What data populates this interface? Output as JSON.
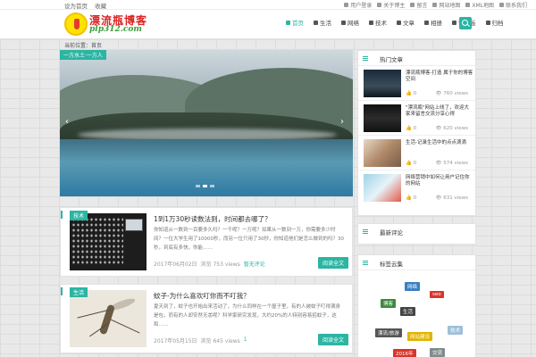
{
  "topbar": {
    "left_links": [
      "设为首页",
      "收藏"
    ],
    "right_links": [
      "用户登录",
      "关于博主",
      "留言",
      "网站地图",
      "XML地图",
      "联系我们"
    ]
  },
  "header": {
    "logo_text": "漂流瓶博客",
    "logo_sub": "plp312.com",
    "nav": [
      {
        "label": "首页",
        "icon": "home-icon",
        "active": true
      },
      {
        "label": "生活",
        "icon": "people-icon",
        "active": false
      },
      {
        "label": "网络",
        "icon": "send-icon",
        "active": false
      },
      {
        "label": "技术",
        "icon": "book-icon",
        "active": false
      },
      {
        "label": "文章",
        "icon": "trophy-icon",
        "active": false
      },
      {
        "label": "相册",
        "icon": "camera-icon",
        "active": false
      },
      {
        "label": "留言板",
        "icon": "chat-icon",
        "active": false
      },
      {
        "label": "归档",
        "icon": "archive-icon",
        "active": false
      }
    ]
  },
  "breadcrumb": "当前位置：首页",
  "slider": {
    "caption": "一方水土·一方人",
    "dots": 3,
    "active_dot": 2
  },
  "posts": [
    {
      "tag": "技术",
      "title": "1到1万30秒读数法则，时间都去哪了？",
      "excerpt": "你知道从一数到一百要多久吗？一千呢？一万呢？如果从一数到一万，你需要多少时间？一位大学生用了10000秒，而另一位只用了30秒，你知道他们是怎么做到的吗？30秒，到底有多快，你能……",
      "date": "2017年06月02日",
      "views": "浏览 753 views",
      "comment": "暂无评论",
      "more": "阅读全文"
    },
    {
      "tag": "生活",
      "title": "蚊子-为什么喜欢叮你而不叮我？",
      "excerpt": "夏天到了，蚊子也开始出来活动了，为什么同样在一个屋子里，有的人被蚊子叮得满身是包，而有的人却安然无恙呢？科学家研究发现，大约20%的人特别容易招蚊子，这和……",
      "date": "2017年05月15日",
      "views": "浏览 645 views",
      "comment": "1",
      "more": "阅读全文"
    }
  ],
  "sidebar": {
    "hot": {
      "title": "热门文章",
      "items": [
        {
          "title": "漂流瓶博客-打造 属于你的博客空间",
          "likes": "0",
          "views": "760 views"
        },
        {
          "title": "\"漂流瓶\"网站上线了，欢迎大家来留言交流分享心得",
          "likes": "0",
          "views": "620 views"
        },
        {
          "title": "生活-记录生活中的点点滴滴",
          "likes": "0",
          "views": "574 views"
        },
        {
          "title": "网络营销中如何让用户记住你的网站",
          "likes": "0",
          "views": "631 views"
        }
      ]
    },
    "recent": {
      "title": "最新评论"
    },
    "tags": {
      "title": "标签云集",
      "items": [
        {
          "label": "网络",
          "color": "#3a7fc1"
        },
        {
          "label": "seo",
          "color": "#d9352a"
        },
        {
          "label": "博客",
          "color": "#3e8a3e"
        },
        {
          "label": "生活",
          "color": "#444444"
        },
        {
          "label": "漂流/旅游",
          "color": "#555555"
        },
        {
          "label": "网站建设",
          "color": "#e0b400"
        },
        {
          "label": "技术",
          "color": "#9ec0d8"
        },
        {
          "label": "2016年",
          "color": "#d9352a"
        },
        {
          "label": "交流",
          "color": "#7f8c8d"
        }
      ]
    }
  },
  "colors": {
    "accent": "#2bb5a3"
  }
}
